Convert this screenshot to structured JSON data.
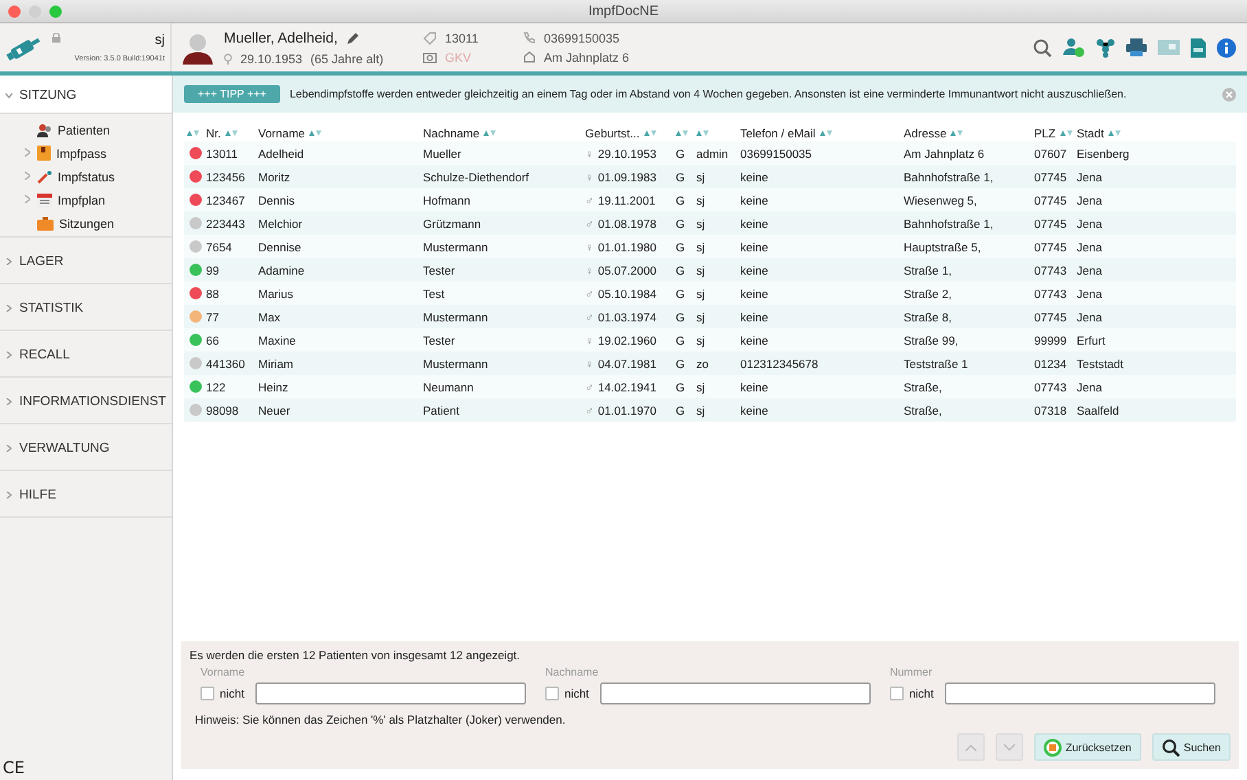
{
  "window": {
    "title": "ImpfDocNE"
  },
  "header": {
    "user": "sj",
    "version": "Version: 3.5.0 Build:19041t",
    "patient": {
      "name": "Mueller, Adelheid,",
      "birth_date": "29.10.1953",
      "age": "(65 Jahre  alt)",
      "number": "13011",
      "insurance": "GKV",
      "phone": "03699150035",
      "address": "Am Jahnplatz 6"
    }
  },
  "sidebar": {
    "sections": [
      {
        "label": "SITZUNG",
        "expanded": true,
        "items": [
          {
            "label": "Patienten",
            "kind": "patients",
            "expandable": false
          },
          {
            "label": "Impfpass",
            "kind": "passport",
            "expandable": true
          },
          {
            "label": "Impfstatus",
            "kind": "syringe",
            "expandable": true
          },
          {
            "label": "Impfplan",
            "kind": "calendar",
            "expandable": true
          },
          {
            "label": "Sitzungen",
            "kind": "briefcase",
            "expandable": false
          }
        ]
      },
      {
        "label": "LAGER",
        "expanded": false
      },
      {
        "label": "STATISTIK",
        "expanded": false
      },
      {
        "label": "RECALL",
        "expanded": false
      },
      {
        "label": "INFORMATIONSDIENST",
        "expanded": false
      },
      {
        "label": "VERWALTUNG",
        "expanded": false
      },
      {
        "label": "HILFE",
        "expanded": false
      }
    ],
    "footer": "CE"
  },
  "tip": {
    "badge": "+++ TIPP +++",
    "text": "Lebendimpfstoffe werden entweder gleichzeitig an einem Tag oder im Abstand von 4 Wochen gegeben. Ansonsten ist eine verminderte Immunantwort nicht auszuschließen."
  },
  "table": {
    "columns": [
      {
        "sortable": true
      },
      {
        "label": "Nr.",
        "sortable": true
      },
      {
        "label": "Vorname",
        "sortable": true
      },
      {
        "label": "Nachname",
        "sortable": true
      },
      {
        "label": "Geburtst...",
        "sortable": true
      },
      {
        "sortable": true
      },
      {
        "sortable": true
      },
      {
        "label": "Telefon / eMail",
        "sortable": true
      },
      {
        "label": "Adresse",
        "sortable": true
      },
      {
        "label": "PLZ",
        "sortable": true
      },
      {
        "label": "Stadt",
        "sortable": true
      }
    ],
    "rows": [
      {
        "color": "#ee4a57",
        "nr": "13011",
        "first": "Adelheid",
        "last": "Mueller",
        "sex": "♀",
        "birth": "29.10.1953",
        "type": "G",
        "user": "admin",
        "phone": "03699150035",
        "address": "Am Jahnplatz 6",
        "zip": "07607",
        "city": "Eisenberg"
      },
      {
        "color": "#ee4a57",
        "nr": "123456",
        "first": "Moritz",
        "last": "Schulze-Diethendorf",
        "sex": "♀",
        "birth": "01.09.1983",
        "type": "G",
        "user": "sj",
        "phone": "keine",
        "address": "Bahnhofstraße 1,",
        "zip": "07745",
        "city": "Jena"
      },
      {
        "color": "#ee4a57",
        "nr": "123467",
        "first": "Dennis",
        "last": "Hofmann",
        "sex": "♂",
        "birth": "19.11.2001",
        "type": "G",
        "user": "sj",
        "phone": "keine",
        "address": "Wiesenweg 5,",
        "zip": "07745",
        "city": "Jena"
      },
      {
        "color": "#c9c9c9",
        "nr": "223443",
        "first": "Melchior",
        "last": "Grützmann",
        "sex": "♂",
        "birth": "01.08.1978",
        "type": "G",
        "user": "sj",
        "phone": "keine",
        "address": "Bahnhofstraße 1,",
        "zip": "07745",
        "city": "Jena"
      },
      {
        "color": "#c9c9c9",
        "nr": "7654",
        "first": "Dennise",
        "last": "Mustermann",
        "sex": "♀",
        "birth": "01.01.1980",
        "type": "G",
        "user": "sj",
        "phone": "keine",
        "address": "Hauptstraße 5,",
        "zip": "07745",
        "city": "Jena"
      },
      {
        "color": "#39c25a",
        "nr": "99",
        "first": "Adamine",
        "last": "Tester",
        "sex": "♀",
        "birth": "05.07.2000",
        "type": "G",
        "user": "sj",
        "phone": "keine",
        "address": "Straße 1,",
        "zip": "07743",
        "city": "Jena"
      },
      {
        "color": "#ee4a57",
        "nr": "88",
        "first": "Marius",
        "last": "Test",
        "sex": "♂",
        "birth": "05.10.1984",
        "type": "G",
        "user": "sj",
        "phone": "keine",
        "address": "Straße 2,",
        "zip": "07743",
        "city": "Jena"
      },
      {
        "color": "#f4b57a",
        "nr": "77",
        "first": "Max",
        "last": "Mustermann",
        "sex": "♂",
        "birth": "01.03.1974",
        "type": "G",
        "user": "sj",
        "phone": "keine",
        "address": "Straße 8,",
        "zip": "07745",
        "city": "Jena"
      },
      {
        "color": "#39c25a",
        "nr": "66",
        "first": "Maxine",
        "last": "Tester",
        "sex": "♀",
        "birth": "19.02.1960",
        "type": "G",
        "user": "sj",
        "phone": "keine",
        "address": "Straße 99,",
        "zip": "99999",
        "city": "Erfurt"
      },
      {
        "color": "#c9c9c9",
        "nr": "441360",
        "first": "Miriam",
        "last": "Mustermann",
        "sex": "♀",
        "birth": "04.07.1981",
        "type": "G",
        "user": "zo",
        "phone": "012312345678",
        "address": "Teststraße 1",
        "zip": "01234",
        "city": "Teststadt"
      },
      {
        "color": "#39c25a",
        "nr": "122",
        "first": "Heinz",
        "last": "Neumann",
        "sex": "♂",
        "birth": "14.02.1941",
        "type": "G",
        "user": "sj",
        "phone": "keine",
        "address": "Straße,",
        "zip": "07743",
        "city": "Jena"
      },
      {
        "color": "#c9c9c9",
        "nr": "98098",
        "first": "Neuer",
        "last": "Patient",
        "sex": "♂",
        "birth": "01.01.1970",
        "type": "G",
        "user": "sj",
        "phone": "keine",
        "address": "Straße,",
        "zip": "07318",
        "city": "Saalfeld"
      }
    ]
  },
  "search": {
    "info": "Es werden die ersten 12 Patienten von insgesamt 12 angezeigt.",
    "fields": [
      {
        "label": "Vorname",
        "negate": "nicht",
        "checked": false
      },
      {
        "label": "Nachname",
        "negate": "nicht",
        "checked": false
      },
      {
        "label": "Nummer",
        "negate": "nicht",
        "checked": false
      }
    ],
    "hint": "Hinweis: Sie können das Zeichen '%' als Platzhalter (Joker) verwenden.",
    "buttons": [
      {
        "kind": "up",
        "disabled": true
      },
      {
        "kind": "down",
        "disabled": true
      },
      {
        "kind": "reset",
        "label": "Zurücksetzen",
        "disabled": false
      },
      {
        "kind": "search",
        "label": "Suchen",
        "disabled": false
      }
    ]
  }
}
